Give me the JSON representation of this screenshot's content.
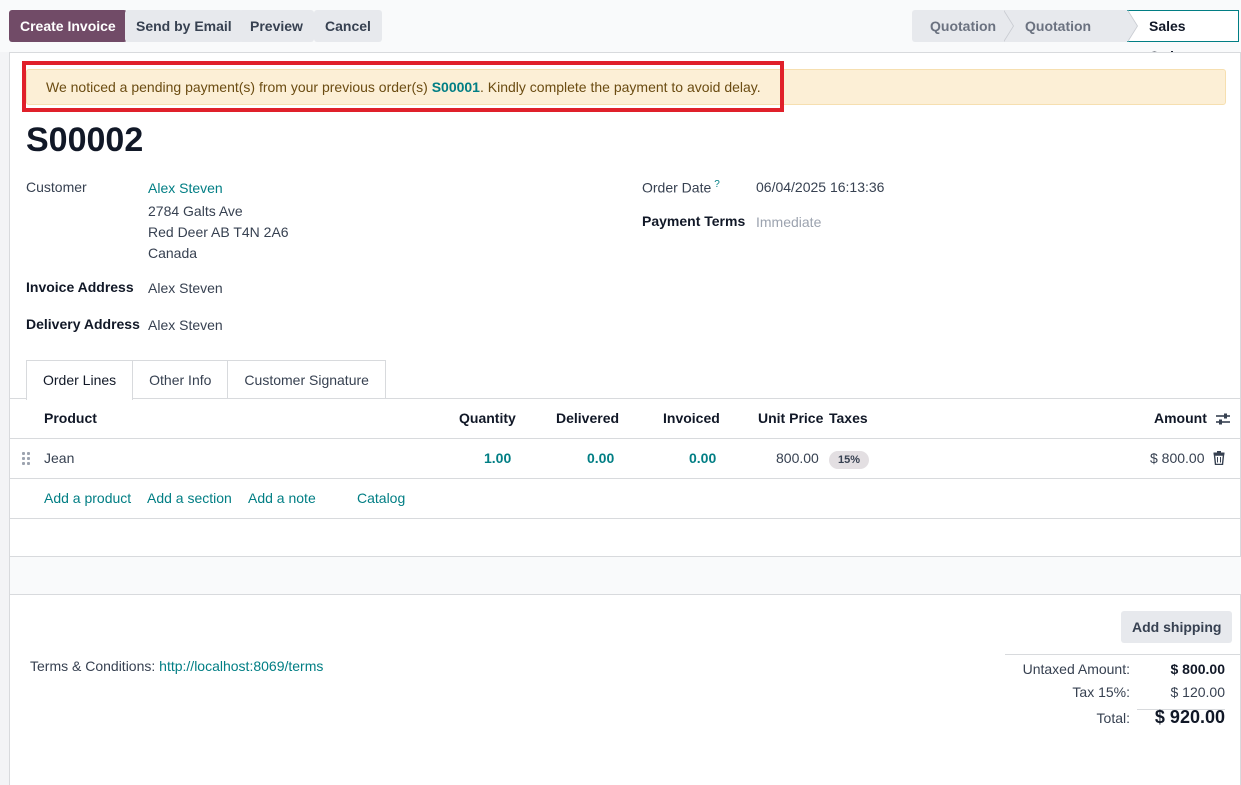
{
  "toolbar": {
    "create_invoice": "Create Invoice",
    "send_email": "Send by Email",
    "preview": "Preview",
    "cancel": "Cancel"
  },
  "status": {
    "stages": [
      "Quotation",
      "Quotation Sent",
      "Sales Order"
    ],
    "active": "Sales Order"
  },
  "alert": {
    "before": "We noticed a pending payment(s) from your previous order(s) ",
    "link": "S00001",
    "after": ". Kindly complete the payment to avoid delay."
  },
  "order": {
    "name": "S00002",
    "customer_label": "Customer",
    "customer_name": "Alex Steven",
    "address_line1": "2784 Galts Ave",
    "address_line2": "Red Deer AB T4N 2A6",
    "address_line3": "Canada",
    "invoice_address_label": "Invoice Address",
    "invoice_address": "Alex Steven",
    "delivery_address_label": "Delivery Address",
    "delivery_address": "Alex Steven",
    "order_date_label": "Order Date",
    "order_date_help": "?",
    "order_date": "06/04/2025 16:13:36",
    "payment_terms_label": "Payment Terms",
    "payment_terms": "Immediate"
  },
  "tabs": [
    "Order Lines",
    "Other Info",
    "Customer Signature"
  ],
  "table": {
    "headers": {
      "product": "Product",
      "quantity": "Quantity",
      "delivered": "Delivered",
      "invoiced": "Invoiced",
      "unit_price": "Unit Price",
      "taxes": "Taxes",
      "amount": "Amount"
    },
    "rows": [
      {
        "product": "Jean",
        "quantity": "1.00",
        "delivered": "0.00",
        "invoiced": "0.00",
        "unit_price": "800.00",
        "tax": "15%",
        "amount": "$ 800.00"
      }
    ],
    "links": {
      "add_product": "Add a product",
      "add_section": "Add a section",
      "add_note": "Add a note",
      "catalog": "Catalog"
    }
  },
  "footer": {
    "add_shipping": "Add shipping",
    "terms_label": "Terms & Conditions: ",
    "terms_link": "http://localhost:8069/terms",
    "untaxed_label": "Untaxed Amount:",
    "untaxed": "$ 800.00",
    "tax_label": "Tax 15%:",
    "tax": "$ 120.00",
    "total_label": "Total:",
    "total": "$ 920.00"
  },
  "colors": {
    "primary": "#714b67",
    "link": "#017e84",
    "alert_bg": "#fcefd6",
    "highlight": "#e0202a"
  }
}
